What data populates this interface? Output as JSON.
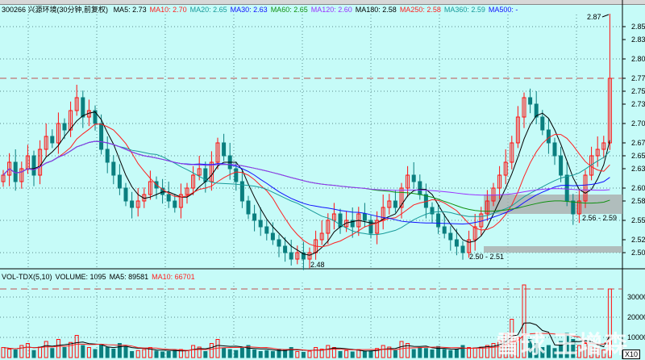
{
  "legend": {
    "symbol": "300266 兴源环境(30分钟,前复权)",
    "items": [
      {
        "label": "MA5: 2.73",
        "color": "#000000"
      },
      {
        "label": "MA10: 2.70",
        "color": "#ff2020"
      },
      {
        "label": "MA20: 2.65",
        "color": "#189a9a"
      },
      {
        "label": "MA30: 2.63",
        "color": "#1010ff"
      },
      {
        "label": "MA60: 2.65",
        "color": "#109010"
      },
      {
        "label": "MA120: 2.60",
        "color": "#9a30ff"
      },
      {
        "label": "MA180: 2.58",
        "color": "#000000"
      },
      {
        "label": "MA250: 2.58",
        "color": "#ff2020"
      },
      {
        "label": "MA360: 2.59",
        "color": "#189a9a"
      },
      {
        "label": "MA500: -",
        "color": "#1010ff"
      }
    ]
  },
  "vol_legend": {
    "items": [
      {
        "label": "VOL-TDX(5,10)",
        "color": "#000000"
      },
      {
        "label": "VOLUME: 1095",
        "color": "#000000"
      },
      {
        "label": "MA5: 89581",
        "color": "#000000"
      },
      {
        "label": "MA10: 66701",
        "color": "#ff2020"
      }
    ]
  },
  "price_axis": [
    "2.85",
    "2.83",
    "2.80",
    "2.77",
    "2.75",
    "2.73",
    "2.70",
    "2.67",
    "2.65",
    "2.63",
    "2.60",
    "2.58",
    "2.55",
    "2.52",
    "2.50"
  ],
  "volume_axis": [
    "30000",
    "20000",
    "10000"
  ],
  "annotations": {
    "high": "2.87",
    "low": "2.48",
    "band_low": "2.50 - 2.51",
    "band_high": "2.56 - 2.59"
  },
  "zones": [
    {
      "from": 2.56,
      "to": 2.59
    },
    {
      "from": 2.5,
      "to": 2.51
    }
  ],
  "ref_price": 2.77,
  "ref_volume": 34000,
  "watermark": "雪球 王增森",
  "scale_label": "X10",
  "colors": {
    "up": "#ff1010",
    "down": "#0a7f7f",
    "bg": "#c6fbf8"
  },
  "chart_data": {
    "type": "candlestick",
    "closes": [
      2.62,
      2.64,
      2.61,
      2.63,
      2.65,
      2.62,
      2.66,
      2.68,
      2.67,
      2.7,
      2.69,
      2.72,
      2.74,
      2.71,
      2.72,
      2.7,
      2.66,
      2.64,
      2.62,
      2.6,
      2.58,
      2.57,
      2.58,
      2.59,
      2.61,
      2.6,
      2.59,
      2.58,
      2.57,
      2.59,
      2.6,
      2.62,
      2.63,
      2.61,
      2.64,
      2.67,
      2.65,
      2.63,
      2.61,
      2.58,
      2.56,
      2.55,
      2.54,
      2.53,
      2.52,
      2.51,
      2.5,
      2.49,
      2.5,
      2.49,
      2.5,
      2.52,
      2.53,
      2.55,
      2.56,
      2.54,
      2.55,
      2.54,
      2.56,
      2.55,
      2.53,
      2.55,
      2.57,
      2.58,
      2.57,
      2.6,
      2.62,
      2.61,
      2.59,
      2.57,
      2.56,
      2.54,
      2.53,
      2.52,
      2.51,
      2.5,
      2.52,
      2.54,
      2.56,
      2.58,
      2.6,
      2.62,
      2.64,
      2.67,
      2.71,
      2.74,
      2.73,
      2.71,
      2.69,
      2.67,
      2.65,
      2.62,
      2.58,
      2.56,
      2.58,
      2.62,
      2.65,
      2.66,
      2.67,
      2.77
    ],
    "volumes": [
      5000,
      4200,
      3800,
      6000,
      7000,
      3500,
      5200,
      8000,
      4500,
      9000,
      5000,
      7500,
      11000,
      6000,
      5000,
      4000,
      6500,
      5000,
      4200,
      7000,
      5500,
      3000,
      3500,
      4000,
      5000,
      3200,
      2800,
      3000,
      3600,
      4000,
      3500,
      6000,
      5200,
      3000,
      7000,
      9000,
      4800,
      4000,
      3500,
      5200,
      6000,
      3800,
      3000,
      3500,
      3000,
      4200,
      3800,
      5000,
      3000,
      2600,
      3200,
      5000,
      4200,
      6000,
      5000,
      3000,
      3500,
      2800,
      4000,
      3000,
      3300,
      4500,
      6000,
      5200,
      3500,
      8000,
      7000,
      4000,
      5000,
      4500,
      3800,
      5500,
      4000,
      3500,
      4200,
      6000,
      5000,
      4800,
      5200,
      6000,
      7000,
      8500,
      12000,
      19000,
      10000,
      36000,
      9000,
      7000,
      5000,
      6000,
      4500,
      8000,
      12000,
      9000,
      6000,
      7000,
      5500,
      4500,
      3800,
      34000
    ],
    "ylim": [
      2.48,
      2.88
    ]
  }
}
